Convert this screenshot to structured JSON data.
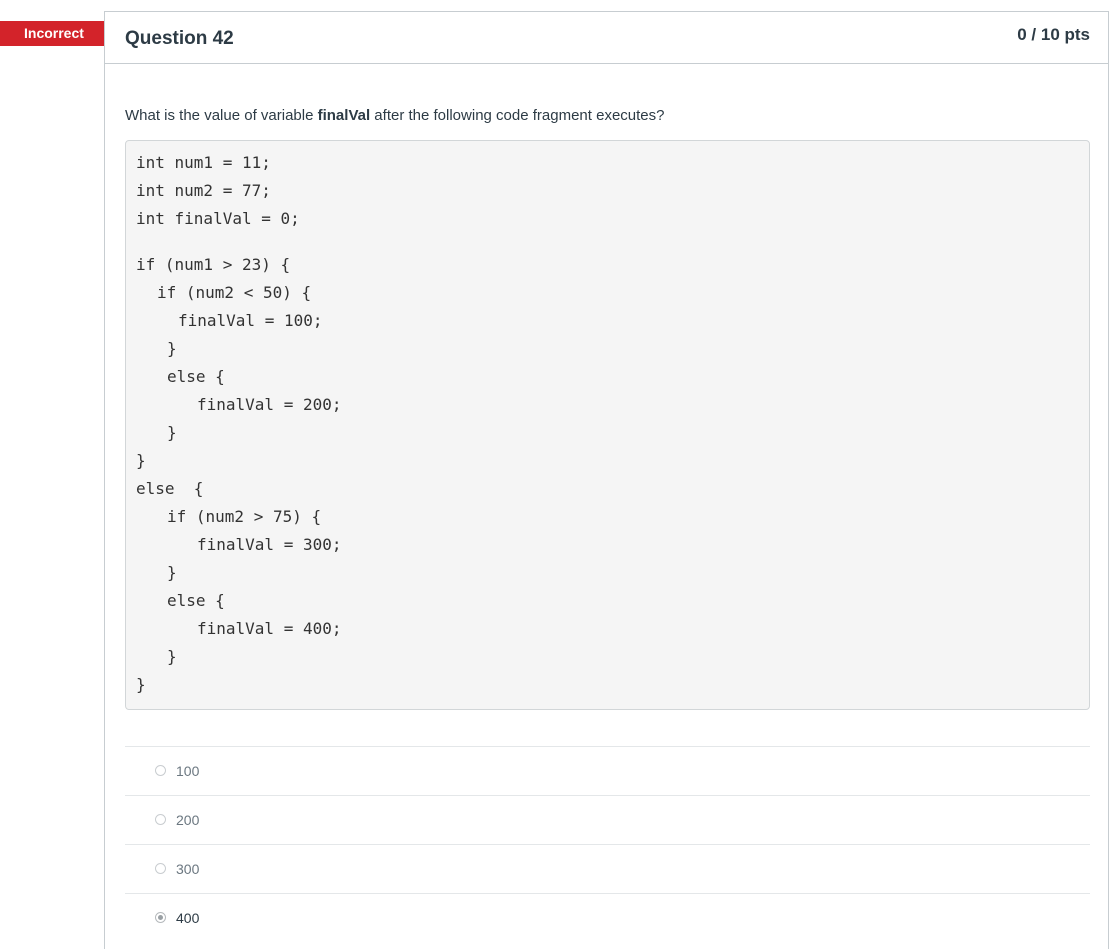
{
  "flag": {
    "label": "Incorrect",
    "color": "#d3232a"
  },
  "question": {
    "title": "Question 42",
    "points": "0 / 10 pts",
    "text_before": "What is the value of variable ",
    "text_bold": "finalVal",
    "text_after": " after the following code fragment executes?"
  },
  "code": [
    "int num1 = 11;",
    "int num2 = 77;",
    "int finalVal = 0;",
    "if (num1 > 23) {",
    "if (num2 < 50) {",
    "finalVal = 100;",
    "}",
    "else {",
    "finalVal = 200;",
    "}",
    "}",
    "else  {",
    "if (num2 > 75) {",
    "finalVal = 300;",
    "}",
    "else {",
    "finalVal = 400;",
    "}",
    "}"
  ],
  "answers": [
    {
      "label": "100",
      "selected": false
    },
    {
      "label": "200",
      "selected": false
    },
    {
      "label": "300",
      "selected": false
    },
    {
      "label": "400",
      "selected": true
    }
  ]
}
